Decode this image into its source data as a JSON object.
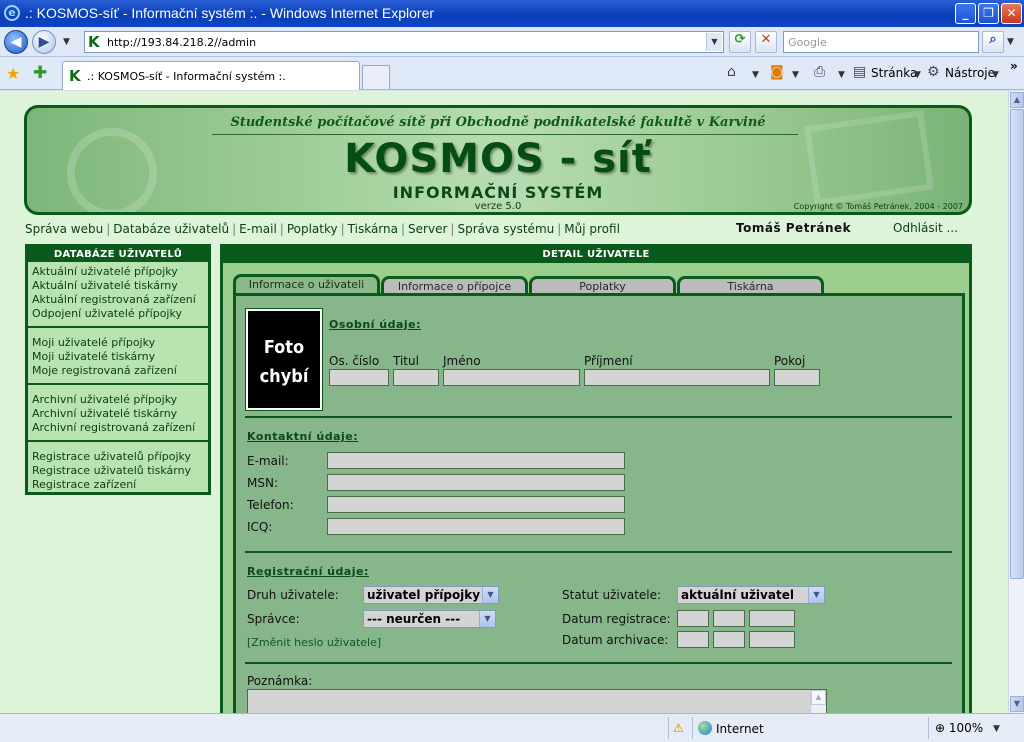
{
  "window": {
    "title": ".: KOSMOS-síť - Informační systém :. - Windows Internet Explorer",
    "controls": {
      "minimize": "_",
      "maximize": "❐",
      "close": "✕"
    }
  },
  "browser": {
    "address": "http://193.84.218.2//admin",
    "search_placeholder": "Google",
    "tab_label": ".: KOSMOS-síť - Informační systém :.",
    "commands": {
      "page": "Stránka",
      "tools": "Nástroje"
    },
    "status": {
      "zone": "Internet",
      "zoom": "100%"
    }
  },
  "site": {
    "tagline": "Studentské počítačové sítě při Obchodně podnikatelské fakultě v Karviné",
    "logo": "KOSMOS - síť",
    "subtitle": "INFORMAČNÍ SYSTÉM",
    "version": "verze 5.0",
    "copyright": "Copyright © Tomáš Petránek, 2004 - 2007"
  },
  "nav": {
    "items": [
      "Správa webu",
      "Databáze uživatelů",
      "E-mail",
      "Poplatky",
      "Tiskárna",
      "Server",
      "Správa systému",
      "Můj profil"
    ],
    "user": "Tomáš Petránek",
    "logout": "Odhlásit ..."
  },
  "sidebar": {
    "title": "Databáze uživatelů",
    "groups": [
      [
        "Aktuální uživatelé přípojky",
        "Aktuální uživatelé tiskárny",
        "Aktuální registrovaná zařízení",
        "Odpojení uživatelé přípojky"
      ],
      [
        "Moji uživatelé přípojky",
        "Moji uživatelé tiskárny",
        "Moje registrovaná zařízení"
      ],
      [
        "Archivní uživatelé přípojky",
        "Archivní uživatelé tiskárny",
        "Archivní registrovaná zařízení"
      ],
      [
        "Registrace uživatelů přípojky",
        "Registrace uživatelů tiskárny",
        "Registrace zařízení"
      ]
    ]
  },
  "detail": {
    "title": "Detail uživatele",
    "tabs": [
      "Informace o uživateli",
      "Informace o přípojce",
      "Poplatky",
      "Tiskárna"
    ],
    "photo": [
      "Foto",
      "chybí"
    ],
    "personal": {
      "title": "Osobní údaje:",
      "labels": [
        "Os. číslo",
        "Titul",
        "Jméno",
        "Příjmení",
        "Pokoj"
      ]
    },
    "contact": {
      "title": "Kontaktní údaje:",
      "labels": [
        "E-mail:",
        "MSN:",
        "Telefon:",
        "ICQ:"
      ]
    },
    "registration": {
      "title": "Registrační údaje:",
      "type_label": "Druh uživatele:",
      "type_value": "uživatel přípojky",
      "admin_label": "Správce:",
      "admin_value": "--- neurčen ---",
      "change_password": "[Změnit heslo uživatele]",
      "status_label": "Statut uživatele:",
      "status_value": "aktuální uživatel",
      "reg_date_label": "Datum registrace:",
      "arch_date_label": "Datum archivace:"
    },
    "note_label": "Poznámka:"
  }
}
